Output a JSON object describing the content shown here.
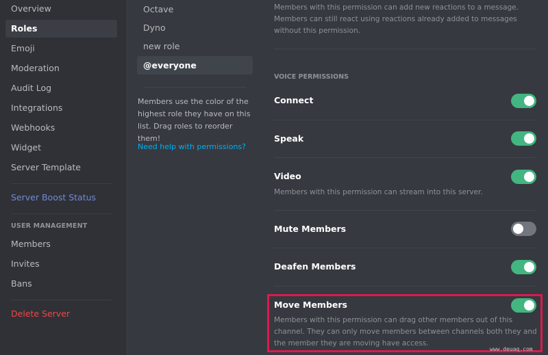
{
  "sidebar": {
    "items": [
      {
        "label": "Overview"
      },
      {
        "label": "Roles",
        "active": true
      },
      {
        "label": "Emoji"
      },
      {
        "label": "Moderation"
      },
      {
        "label": "Audit Log"
      },
      {
        "label": "Integrations"
      },
      {
        "label": "Webhooks"
      },
      {
        "label": "Widget"
      },
      {
        "label": "Server Template"
      }
    ],
    "boost": "Server Boost Status",
    "user_management_header": "USER MANAGEMENT",
    "user_items": [
      {
        "label": "Members"
      },
      {
        "label": "Invites"
      },
      {
        "label": "Bans"
      }
    ],
    "delete": "Delete Server"
  },
  "roles": {
    "items": [
      {
        "label": "Octave"
      },
      {
        "label": "Dyno"
      },
      {
        "label": "new role"
      },
      {
        "label": "@everyone",
        "active": true
      }
    ],
    "help_text": "Members use the color of the highest role they have on this list. Drag roles to reorder them!",
    "help_link": "Need help with permissions?"
  },
  "permissions": {
    "top_description": "Members with this permission can add new reactions to a message. Members can still react using reactions already added to messages without this permission.",
    "section": "VOICE PERMISSIONS",
    "items": [
      {
        "title": "Connect",
        "enabled": true,
        "description": ""
      },
      {
        "title": "Speak",
        "enabled": true,
        "description": ""
      },
      {
        "title": "Video",
        "enabled": true,
        "description": "Members with this permission can stream into this server."
      },
      {
        "title": "Mute Members",
        "enabled": false,
        "description": ""
      },
      {
        "title": "Deafen Members",
        "enabled": true,
        "description": ""
      },
      {
        "title": "Move Members",
        "enabled": true,
        "description": "Members with this permission can drag other members out of this channel. They can only move members between channels both they and the member they are moving have access."
      }
    ]
  },
  "watermark": "www.deuaq.com",
  "colors": {
    "toggle_on": "#43b581",
    "toggle_off": "#72767d",
    "highlight": "#e0184c",
    "link": "#00b0f4",
    "boost": "#7289da",
    "danger": "#f04747"
  }
}
